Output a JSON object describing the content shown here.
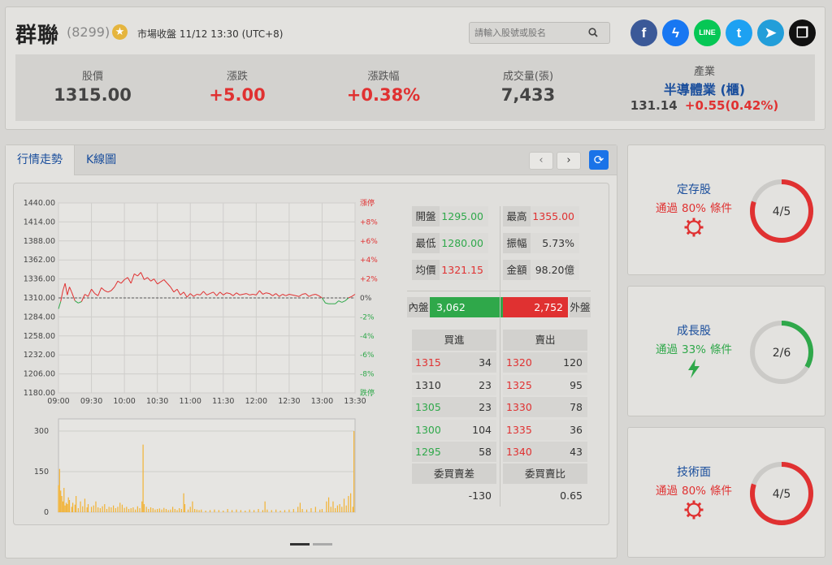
{
  "stock": {
    "name": "群聯",
    "code": "(8299)",
    "market_status": "市場收盤 11/12 13:30 (UTC+8)"
  },
  "search": {
    "placeholder": "請輸入股號或股名"
  },
  "social": [
    {
      "name": "facebook-icon",
      "glyph": "f",
      "color": "#3b5998"
    },
    {
      "name": "messenger-icon",
      "glyph": "ϟ",
      "color": "#1877f2"
    },
    {
      "name": "line-icon",
      "glyph": "LINE",
      "color": "#06c755"
    },
    {
      "name": "twitter-icon",
      "glyph": "t",
      "color": "#1da1f2"
    },
    {
      "name": "telegram-icon",
      "glyph": "➤",
      "color": "#229ed9"
    },
    {
      "name": "copy-icon",
      "glyph": "❐",
      "color": "#111111"
    }
  ],
  "quote": {
    "price_label": "股價",
    "price": "1315.00",
    "change_label": "漲跌",
    "change": "+5.00",
    "pct_label": "漲跌幅",
    "pct": "+0.38%",
    "volume_label": "成交量(張)",
    "volume": "7,433",
    "industry_label": "產業",
    "industry": "半導體業 (櫃)",
    "industry_index": "131.14",
    "industry_change": "+0.55(0.42%)"
  },
  "tabs": [
    "行情走勢",
    "K線圖"
  ],
  "nav": {
    "prev": "‹",
    "next": "›",
    "refresh": "⟳"
  },
  "chart_data": {
    "type": "line",
    "x_ticks": [
      "09:00",
      "09:30",
      "10:00",
      "10:30",
      "11:00",
      "11:30",
      "12:00",
      "12:30",
      "13:00",
      "13:30"
    ],
    "y_ticks": [
      "1440.00",
      "1414.00",
      "1388.00",
      "1362.00",
      "1336.00",
      "1310.00",
      "1284.00",
      "1258.00",
      "1232.00",
      "1206.00",
      "1180.00"
    ],
    "pct_ticks": [
      "漲停",
      "+8%",
      "+6%",
      "+4%",
      "+2%",
      "0%",
      "-2%",
      "-4%",
      "-6%",
      "-8%",
      "跌停"
    ],
    "ylim": [
      1180,
      1440
    ],
    "reference": 1310,
    "price_series": [
      [
        0,
        1295
      ],
      [
        2,
        1305
      ],
      [
        4,
        1320
      ],
      [
        6,
        1330
      ],
      [
        8,
        1314
      ],
      [
        10,
        1325
      ],
      [
        12,
        1318
      ],
      [
        15,
        1306
      ],
      [
        18,
        1303
      ],
      [
        21,
        1305
      ],
      [
        24,
        1315
      ],
      [
        27,
        1312
      ],
      [
        30,
        1322
      ],
      [
        33,
        1316
      ],
      [
        36,
        1313
      ],
      [
        39,
        1324
      ],
      [
        42,
        1320
      ],
      [
        45,
        1318
      ],
      [
        48,
        1320
      ],
      [
        51,
        1325
      ],
      [
        54,
        1333
      ],
      [
        57,
        1330
      ],
      [
        60,
        1335
      ],
      [
        63,
        1338
      ],
      [
        66,
        1330
      ],
      [
        69,
        1343
      ],
      [
        72,
        1340
      ],
      [
        75,
        1345
      ],
      [
        78,
        1335
      ],
      [
        81,
        1338
      ],
      [
        84,
        1333
      ],
      [
        87,
        1336
      ],
      [
        90,
        1329
      ],
      [
        93,
        1332
      ],
      [
        96,
        1335
      ],
      [
        99,
        1330
      ],
      [
        102,
        1325
      ],
      [
        105,
        1318
      ],
      [
        108,
        1322
      ],
      [
        111,
        1314
      ],
      [
        114,
        1318
      ],
      [
        117,
        1311
      ],
      [
        120,
        1316
      ],
      [
        123,
        1312
      ],
      [
        126,
        1315
      ],
      [
        129,
        1314
      ],
      [
        132,
        1319
      ],
      [
        135,
        1314
      ],
      [
        138,
        1316
      ],
      [
        141,
        1318
      ],
      [
        144,
        1313
      ],
      [
        147,
        1318
      ],
      [
        150,
        1314
      ],
      [
        153,
        1317
      ],
      [
        156,
        1316
      ],
      [
        159,
        1313
      ],
      [
        162,
        1317
      ],
      [
        165,
        1314
      ],
      [
        168,
        1315
      ],
      [
        171,
        1316
      ],
      [
        174,
        1314
      ],
      [
        177,
        1315
      ],
      [
        180,
        1314
      ],
      [
        183,
        1320
      ],
      [
        186,
        1315
      ],
      [
        189,
        1317
      ],
      [
        192,
        1316
      ],
      [
        195,
        1313
      ],
      [
        198,
        1316
      ],
      [
        201,
        1312
      ],
      [
        204,
        1315
      ],
      [
        207,
        1313
      ],
      [
        210,
        1315
      ],
      [
        213,
        1314
      ],
      [
        216,
        1313
      ],
      [
        219,
        1312
      ],
      [
        222,
        1315
      ],
      [
        225,
        1316
      ],
      [
        228,
        1312
      ],
      [
        231,
        1314
      ],
      [
        234,
        1315
      ],
      [
        237,
        1313
      ],
      [
        240,
        1310
      ],
      [
        243,
        1303
      ],
      [
        246,
        1302
      ],
      [
        249,
        1302
      ],
      [
        252,
        1302
      ],
      [
        255,
        1306
      ],
      [
        258,
        1304
      ],
      [
        261,
        1306
      ],
      [
        264,
        1310
      ],
      [
        267,
        1312
      ],
      [
        270,
        1315
      ]
    ],
    "volume_ticks": [
      "300",
      "150",
      "0"
    ],
    "volume_max": 300,
    "volume_series": [
      [
        0,
        100
      ],
      [
        1,
        160
      ],
      [
        2,
        80
      ],
      [
        3,
        60
      ],
      [
        4,
        40
      ],
      [
        5,
        90
      ],
      [
        6,
        25
      ],
      [
        7,
        35
      ],
      [
        8,
        30
      ],
      [
        9,
        55
      ],
      [
        10,
        45
      ],
      [
        12,
        20
      ],
      [
        13,
        35
      ],
      [
        15,
        28
      ],
      [
        16,
        60
      ],
      [
        18,
        15
      ],
      [
        20,
        40
      ],
      [
        22,
        22
      ],
      [
        24,
        50
      ],
      [
        26,
        18
      ],
      [
        27,
        30
      ],
      [
        30,
        20
      ],
      [
        32,
        25
      ],
      [
        34,
        40
      ],
      [
        36,
        18
      ],
      [
        38,
        15
      ],
      [
        40,
        22
      ],
      [
        42,
        30
      ],
      [
        44,
        12
      ],
      [
        46,
        20
      ],
      [
        48,
        18
      ],
      [
        50,
        25
      ],
      [
        52,
        15
      ],
      [
        54,
        20
      ],
      [
        56,
        35
      ],
      [
        58,
        28
      ],
      [
        60,
        16
      ],
      [
        62,
        20
      ],
      [
        64,
        12
      ],
      [
        66,
        15
      ],
      [
        68,
        18
      ],
      [
        70,
        10
      ],
      [
        72,
        22
      ],
      [
        74,
        15
      ],
      [
        76,
        40
      ],
      [
        77,
        250
      ],
      [
        78,
        30
      ],
      [
        80,
        20
      ],
      [
        82,
        12
      ],
      [
        84,
        18
      ],
      [
        86,
        15
      ],
      [
        88,
        10
      ],
      [
        90,
        12
      ],
      [
        92,
        14
      ],
      [
        94,
        10
      ],
      [
        96,
        16
      ],
      [
        98,
        12
      ],
      [
        100,
        8
      ],
      [
        102,
        10
      ],
      [
        104,
        20
      ],
      [
        106,
        12
      ],
      [
        108,
        8
      ],
      [
        110,
        15
      ],
      [
        112,
        12
      ],
      [
        114,
        70
      ],
      [
        115,
        30
      ],
      [
        118,
        10
      ],
      [
        120,
        20
      ],
      [
        122,
        40
      ],
      [
        124,
        12
      ],
      [
        126,
        10
      ],
      [
        128,
        8
      ],
      [
        130,
        10
      ],
      [
        134,
        6
      ],
      [
        138,
        8
      ],
      [
        142,
        10
      ],
      [
        146,
        8
      ],
      [
        150,
        6
      ],
      [
        154,
        12
      ],
      [
        158,
        8
      ],
      [
        162,
        10
      ],
      [
        166,
        8
      ],
      [
        170,
        6
      ],
      [
        174,
        10
      ],
      [
        178,
        8
      ],
      [
        182,
        12
      ],
      [
        186,
        8
      ],
      [
        188,
        40
      ],
      [
        190,
        10
      ],
      [
        194,
        8
      ],
      [
        198,
        10
      ],
      [
        202,
        6
      ],
      [
        206,
        8
      ],
      [
        210,
        10
      ],
      [
        214,
        12
      ],
      [
        218,
        20
      ],
      [
        220,
        35
      ],
      [
        222,
        12
      ],
      [
        226,
        10
      ],
      [
        230,
        15
      ],
      [
        234,
        20
      ],
      [
        238,
        10
      ],
      [
        240,
        12
      ],
      [
        244,
        40
      ],
      [
        246,
        55
      ],
      [
        248,
        20
      ],
      [
        250,
        40
      ],
      [
        252,
        15
      ],
      [
        254,
        25
      ],
      [
        256,
        30
      ],
      [
        258,
        20
      ],
      [
        260,
        50
      ],
      [
        262,
        25
      ],
      [
        264,
        60
      ],
      [
        266,
        70
      ],
      [
        268,
        20
      ],
      [
        269,
        300
      ]
    ]
  },
  "stats": [
    {
      "label": "開盤",
      "value": "1295.00",
      "color": "green"
    },
    {
      "label": "最高",
      "value": "1355.00",
      "color": "red"
    },
    {
      "label": "最低",
      "value": "1280.00",
      "color": "green"
    },
    {
      "label": "振幅",
      "value": "5.73%",
      "color": "plain"
    },
    {
      "label": "均價",
      "value": "1321.15",
      "color": "red"
    },
    {
      "label": "金額",
      "value": "98.20億",
      "color": "plain"
    }
  ],
  "inout": {
    "in_label": "內盤",
    "in_value": "3,062",
    "out_label": "外盤",
    "out_value": "2,752",
    "in_ratio": 0.527
  },
  "order_book": {
    "bid_label": "買進",
    "ask_label": "賣出",
    "bids": [
      {
        "price": "1315",
        "qty": "34",
        "color": "red"
      },
      {
        "price": "1310",
        "qty": "23",
        "color": "plain"
      },
      {
        "price": "1305",
        "qty": "23",
        "color": "green"
      },
      {
        "price": "1300",
        "qty": "104",
        "color": "green"
      },
      {
        "price": "1295",
        "qty": "58",
        "color": "green"
      }
    ],
    "asks": [
      {
        "price": "1320",
        "qty": "120",
        "color": "red"
      },
      {
        "price": "1325",
        "qty": "95",
        "color": "red"
      },
      {
        "price": "1330",
        "qty": "78",
        "color": "red"
      },
      {
        "price": "1335",
        "qty": "36",
        "color": "red"
      },
      {
        "price": "1340",
        "qty": "43",
        "color": "red"
      }
    ],
    "diff_label": "委買賣差",
    "diff_value": "-130",
    "ratio_label": "委買賣比",
    "ratio_value": "0.65"
  },
  "scorecards": [
    {
      "title": "定存股",
      "pass_prefix": "通過",
      "pass_pct": "80%",
      "pass_suffix": "條件",
      "score": "4/5",
      "ratio": 0.8,
      "color": "#e03131",
      "icon": "gear-icon"
    },
    {
      "title": "成長股",
      "pass_prefix": "通過",
      "pass_pct": "33%",
      "pass_suffix": "條件",
      "score": "2/6",
      "ratio": 0.333,
      "color": "#2fa84a",
      "icon": "lightning-icon"
    },
    {
      "title": "技術面",
      "pass_prefix": "通過",
      "pass_pct": "80%",
      "pass_suffix": "條件",
      "score": "4/5",
      "ratio": 0.8,
      "color": "#e03131",
      "icon": "gear-icon"
    }
  ]
}
